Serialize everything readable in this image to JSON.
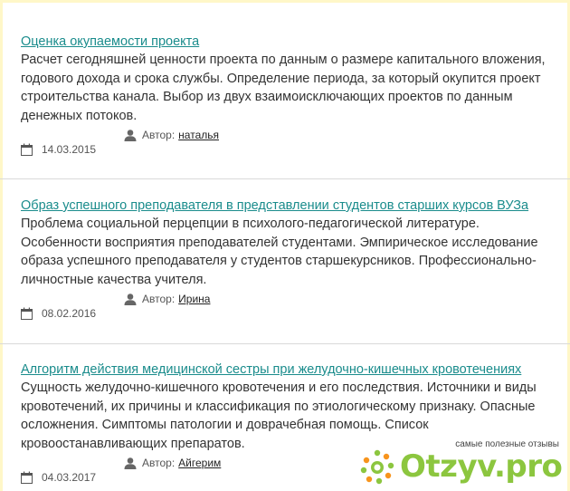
{
  "articles": [
    {
      "title": "Оценка окупаемости проекта",
      "description": "Расчет сегодняшней ценности проекта по данным о размере капитального вложения, годового дохода и срока службы. Определение периода, за который окупится проект строительства канала. Выбор из двух взаимоисключающих проектов по данным денежных потоков.",
      "date": "14.03.2015",
      "author_label": "Автор:",
      "author_name": "наталья"
    },
    {
      "title": "Образ успешного преподавателя в представлении студентов старших курсов ВУЗа",
      "description": "Проблема социальной перцепции в психолого-педагогической литературе. Особенности восприятия преподавателей студентами. Эмпирическое исследование образа успешного преподавателя у студентов старшекурсников. Профессионально-личностные качества учителя.",
      "date": "08.02.2016",
      "author_label": "Автор:",
      "author_name": "Ирина"
    },
    {
      "title": "Алгоритм действия медицинской сестры при желудочно-кишечных кровотечениях",
      "description": "Сущность желудочно-кишечного кровотечения и его последствия. Источники и виды кровотечений, их причины и классификация по этиологическому признаку. Опасные осложнения. Симптомы патологии и доврачебная помощь. Список кровоостанавливающих препаратов.",
      "date": "04.03.2017",
      "author_label": "Автор:",
      "author_name": "Айгерим"
    }
  ],
  "watermark": {
    "tagline": "самые полезные отзывы",
    "brand": "Otzyv.pro"
  },
  "colors": {
    "title_link": "#1a8c8c",
    "brand_green": "#8cc63f",
    "frame": "#fff7c8"
  },
  "icons": {
    "date": "calendar-icon",
    "author": "user-icon",
    "watermark": "otzyv-logo-icon"
  }
}
